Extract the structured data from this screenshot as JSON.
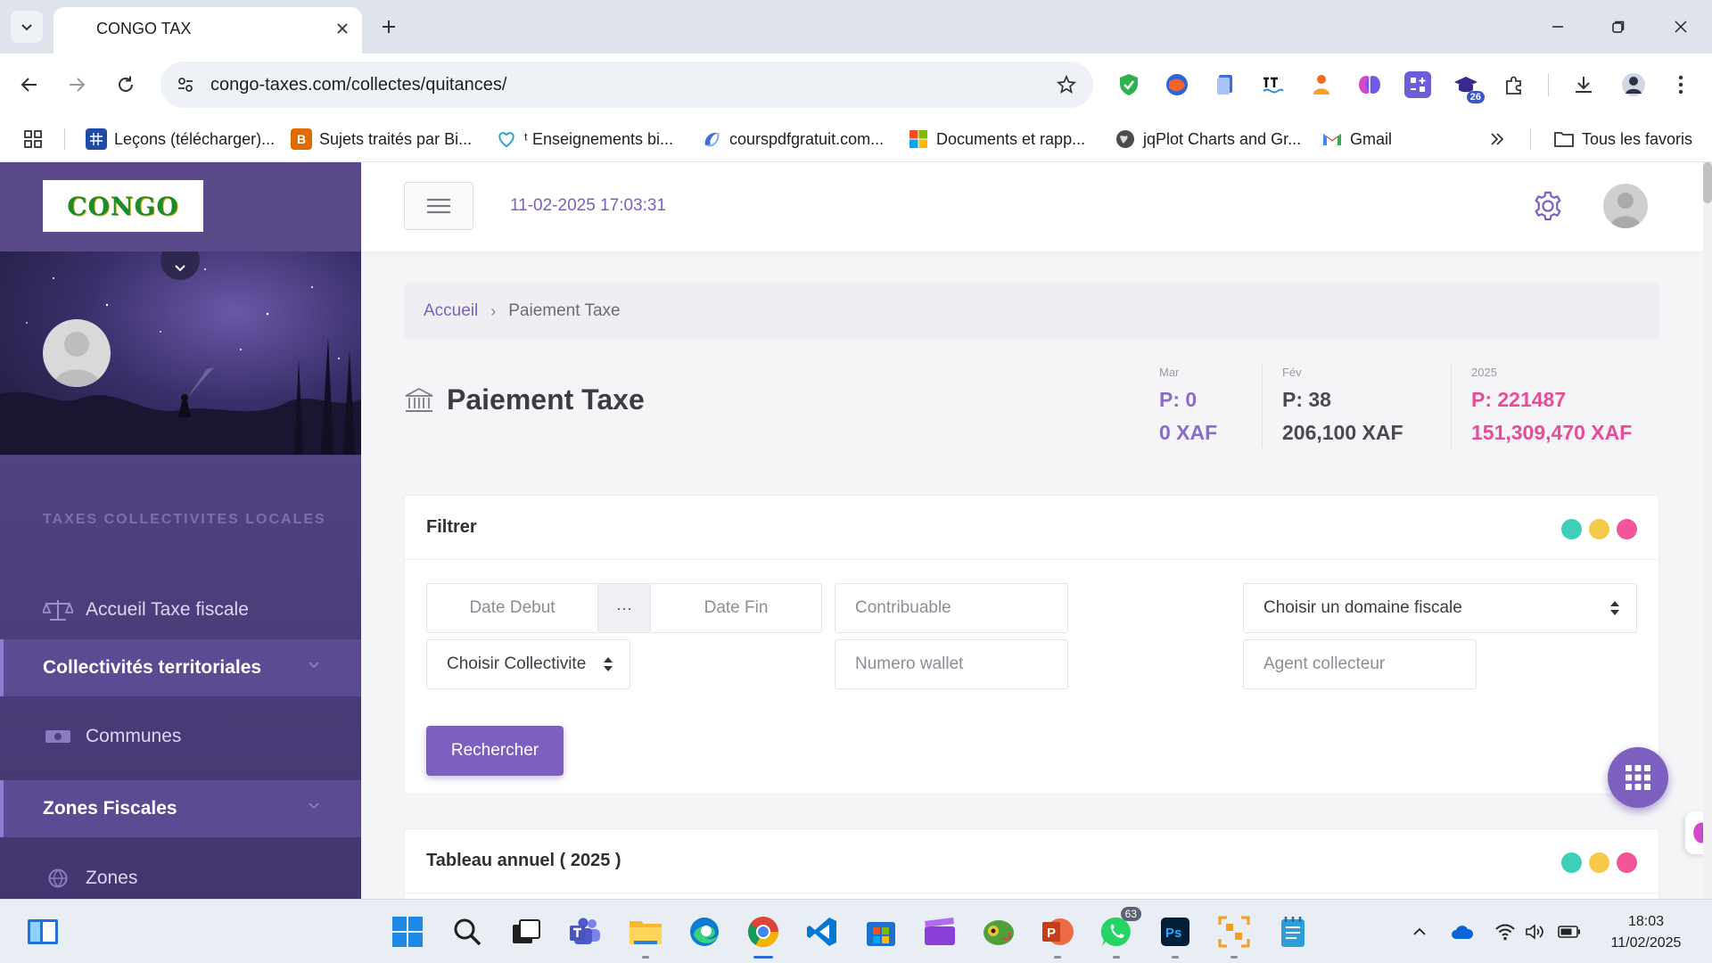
{
  "browser": {
    "tab_title": "CONGO TAX",
    "url": "congo-taxes.com/collectes/quitances/",
    "bookmarks": [
      {
        "label": "Leçons (télécharger)...",
        "icon": "grid-icon",
        "color": "#1f4aa8"
      },
      {
        "label": "Sujets traités par Bi...",
        "icon": "letter-b-icon",
        "color": "#e06b00"
      },
      {
        "label": "ᵗ Enseignements bi...",
        "icon": "heart-outline-icon",
        "color": "#2aa6c9"
      },
      {
        "label": "courspdfgratuit.com...",
        "icon": "swirl-icon",
        "color": "#3b6fd8"
      },
      {
        "label": "Documents et rapp...",
        "icon": "windows-logo-icon",
        "color": "#f25022"
      },
      {
        "label": "jqPlot Charts and Gr...",
        "icon": "globe-icon",
        "color": "#555555"
      },
      {
        "label": "Gmail",
        "icon": "gmail-icon",
        "color": "#d93025"
      }
    ],
    "all_bookmarks_label": "Tous les favoris",
    "extension_badge": "26"
  },
  "app": {
    "logo_text": "CONGO",
    "datetime": "11-02-2025 17:03:31",
    "sidebar": {
      "section_title": "TAXES COLLECTIVITES LOCALES",
      "items": [
        {
          "label": "Accueil Taxe fiscale",
          "icon": "scale-icon",
          "group": false
        },
        {
          "label": "Collectivités territoriales",
          "icon": "",
          "group": true
        },
        {
          "label": "Communes",
          "icon": "money-icon",
          "group": false
        },
        {
          "label": "Zones Fiscales",
          "icon": "",
          "group": true
        },
        {
          "label": "Zones",
          "icon": "globe-icon",
          "group": false
        }
      ]
    },
    "breadcrumb": {
      "home": "Accueil",
      "current": "Paiement Taxe"
    },
    "page_title": "Paiement Taxe",
    "stats": [
      {
        "label": "Mar",
        "count": "P: 0",
        "amount": "0 XAF",
        "color": "#8b6cc8"
      },
      {
        "label": "Fév",
        "count": "P: 38",
        "amount": "206,100 XAF",
        "color": "#4a4a52"
      },
      {
        "label": "2025",
        "count": "P: 221487",
        "amount": "151,309,470 XAF",
        "color": "#e64c9a"
      }
    ],
    "filter": {
      "title": "Filtrer",
      "date_debut": "Date  Debut",
      "range_sep": "···",
      "date_fin": "Date  Fin",
      "contribuable": "Contribuable",
      "domaine_select": "Choisir un domaine fiscale",
      "collectivite_select": "Choisir Collectivite",
      "numero_wallet": "Numero wallet",
      "agent_collecteur": "Agent collecteur",
      "search_button": "Rechercher"
    },
    "annual_table": {
      "title": "Tableau annuel ( 2025 )"
    },
    "card_dots": [
      "#3ecfb8",
      "#f7c948",
      "#f2559a"
    ],
    "accent_color": "#7d5fc0"
  },
  "taskbar": {
    "time": "18:03",
    "date": "11/02/2025",
    "whatsapp_badge": "63"
  }
}
